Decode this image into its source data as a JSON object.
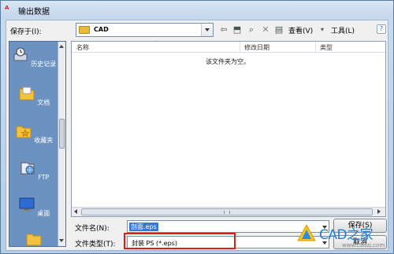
{
  "window": {
    "title": "输出数据",
    "app_icon_text": "A"
  },
  "toolbar": {
    "save_in_label": "保存于(I):",
    "save_in_value": "CAD",
    "view_label": "查看(V)",
    "tools_label": "工具(L)",
    "help_label": "?"
  },
  "places": [
    {
      "label": "历史记录",
      "icon": "history-icon"
    },
    {
      "label": "文档",
      "icon": "documents-folder-icon"
    },
    {
      "label": "收藏夹",
      "icon": "favorites-folder-icon"
    },
    {
      "label": "FTP",
      "icon": "ftp-icon"
    },
    {
      "label": "桌面",
      "icon": "desktop-icon"
    }
  ],
  "file_list": {
    "columns": [
      "名称",
      "修改日期",
      "类型"
    ],
    "empty_message": "该文件夹为空。"
  },
  "fields": {
    "file_name_label": "文件名(N):",
    "file_name_value": "剖面.eps",
    "file_type_label": "文件类型(T):",
    "file_type_value": "封装 PS (*.eps)"
  },
  "buttons": {
    "save": "保存(S)",
    "cancel": "取消"
  },
  "watermark": {
    "text": "CAD之家",
    "url": "www.cadzj.com"
  },
  "colors": {
    "places_bar": "#6c92c2",
    "highlight_box": "#d62020",
    "selection": "#3a76d2"
  }
}
